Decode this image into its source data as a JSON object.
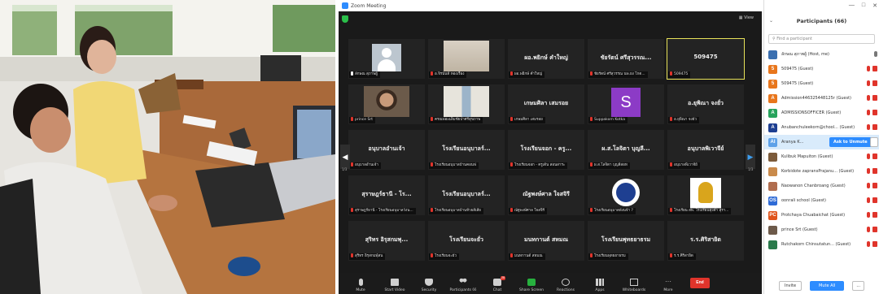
{
  "zoom": {
    "window_title": "Zoom Meeting",
    "view_label": "View",
    "page_left": "1/3",
    "page_right": "1/3",
    "tiles": [
      {
        "name": "",
        "label": "ลักษณ สุภาพผู้",
        "kind": "avatar",
        "mic_on": true
      },
      {
        "name": "",
        "label": "อ.จิรนันท์ ทองเรือง",
        "kind": "photo",
        "mic_on": false
      },
      {
        "name": "ผอ.พยิกษ์ คำใหญ่",
        "label": "ผอ.พยิกษ์ คำใหญ่",
        "kind": "text",
        "mic_on": false
      },
      {
        "name": "ชัยรัตน์ ศรีสุวรรณ...",
        "label": "ชัยรัตน์ ศรีสุวรรณ นพ.ยง โกต...",
        "kind": "text",
        "mic_on": false
      },
      {
        "name": "509475",
        "label": "509475",
        "kind": "text",
        "mic_on": false,
        "active": true
      },
      {
        "name": "",
        "label": "prince Srt",
        "kind": "photo2",
        "mic_on": false
      },
      {
        "name": "",
        "label": "ครณพ่อเฉลิมชัยป่าศรีสุขภาพ",
        "kind": "photo3",
        "mic_on": false
      },
      {
        "name": "เกษมศิลา เสมรอย",
        "label": "เกษมศิลา เสมรอย",
        "kind": "text",
        "mic_on": false
      },
      {
        "name": "",
        "label": "Suppakorn Kotka",
        "kind": "s",
        "mic_on": false
      },
      {
        "name": "อ.ยุพิณา จงยั่ว",
        "label": "อ.ยุพิณา จงยั่ว",
        "kind": "text",
        "mic_on": false
      },
      {
        "name": "อนุบาลอำนเจ้า",
        "label": "อนุบาลอำนเจ้า",
        "kind": "text",
        "mic_on": false
      },
      {
        "name": "โรงเรียนอนุบาลร์...",
        "label": "โรงเรียนอนุบาลบ้านคอนฟ",
        "kind": "text",
        "mic_on": false
      },
      {
        "name": "โรงเรียนจอก - ครู...",
        "label": "โรงเรียนจอก - ครูเต้น สอนสาระ",
        "kind": "text",
        "mic_on": false
      },
      {
        "name": "ผ.ส.โลจิตา บุญลี...",
        "label": "ผ.ส.โลจิตา บุญลีสอท",
        "kind": "text",
        "mic_on": false
      },
      {
        "name": "อนุบาลพิเวาจีย์",
        "label": "อนุบาลพิเวาจีย์",
        "kind": "text",
        "mic_on": false
      },
      {
        "name": "สุราษฎร์ธานี - โร...",
        "label": "สุราษฎร์ธานี - โรงเรียนอนุบาลวังน...",
        "kind": "text",
        "mic_on": false
      },
      {
        "name": "โรงเรียนอนุบาลร์...",
        "label": "โรงเรียนอนุบาลบ้านห้วยสีเสีย",
        "kind": "text",
        "mic_on": false
      },
      {
        "name": "ณัฐพงษ์ศาล ใจสจิรี",
        "label": "ณัฐพงษ์ศาล ใจสจิรี",
        "kind": "text",
        "mic_on": false
      },
      {
        "name": "",
        "label": "โรงเรียนอนุบาลพังนจ้า ?",
        "kind": "logo1",
        "mic_on": false
      },
      {
        "name": "",
        "label": "โรงเรียน สพ. โรงเรียนทุ่งตำ สุรา...",
        "kind": "logo2",
        "mic_on": false
      },
      {
        "name": "สุริทร อิรุสกมพุ...",
        "label": "สุริทร อิรุสกมพุ์สน",
        "kind": "text",
        "mic_on": false
      },
      {
        "name": "โรงเรียนจะยั่ว",
        "label": "โรงเรียนจะยั่ว",
        "kind": "text",
        "mic_on": false
      },
      {
        "name": "มนทกานต์ สหมณ",
        "label": "มนทกานต์ สหมณ",
        "kind": "text",
        "mic_on": false
      },
      {
        "name": "โรงเรียนพุทธยาธรม",
        "label": "โรงเรียนพุทธยาธรม",
        "kind": "text",
        "mic_on": false
      },
      {
        "name": "ร.ร.ศิริสายิด",
        "label": "ร.ร.ศิริสายิด",
        "kind": "text",
        "mic_on": false
      }
    ],
    "toolbar": {
      "mute": "Mute",
      "start_video": "Start Video",
      "security": "Security",
      "participants": "Participants",
      "participants_count": "66",
      "chat": "Chat",
      "chat_badge": "28",
      "share_screen": "Share Screen",
      "reactions": "Reactions",
      "apps": "Apps",
      "whiteboards": "Whiteboards",
      "more": "More",
      "end": "End"
    }
  },
  "panel": {
    "win_min": "—",
    "win_max": "□",
    "win_close": "✕",
    "title": "Participants (66)",
    "search_placeholder": "Find a participant",
    "participants": [
      {
        "name": "ลักษณ สุภาพผู้ (Host, me)",
        "color": "#3a6fb0",
        "initial": "",
        "photo": true,
        "mic_on": true,
        "cam": false
      },
      {
        "name": "509475 (Guest)",
        "color": "#e8761c",
        "initial": "5",
        "mic_on": false,
        "cam": true
      },
      {
        "name": "509475 (Guest)",
        "color": "#e8761c",
        "initial": "5",
        "mic_on": false,
        "cam": true
      },
      {
        "name": "Admission446325448125r (Guest)",
        "color": "#e8761c",
        "initial": "A",
        "mic_on": false,
        "cam": true
      },
      {
        "name": "ADMISSIONSOFFICER (Guest)",
        "color": "#27a35c",
        "initial": "A",
        "mic_on": false,
        "cam": true
      },
      {
        "name": "Anubanchuleekorn@chool... (Guest)",
        "color": "#1e3f91",
        "initial": "A",
        "mic_on": false,
        "cam": true
      },
      {
        "name": "Aranya K...",
        "color": "#5ea1e8",
        "initial": "AI",
        "mic_on": false,
        "cam": false,
        "highlight": true,
        "unmute": "Ask to Unmute"
      },
      {
        "name": "Kulibuk Mapuiton (Guest)",
        "color": "#7c5b3a",
        "initial": "",
        "photo": true,
        "mic_on": false,
        "cam": true
      },
      {
        "name": "Korbidote zapransPrajanu... (Guest)",
        "color": "#c98a4b",
        "initial": "",
        "photo": true,
        "mic_on": false,
        "cam": true
      },
      {
        "name": "Naowanon Chanbroang (Guest)",
        "color": "#b06d4e",
        "initial": "",
        "photo": true,
        "mic_on": false,
        "cam": true
      },
      {
        "name": "oonrali school (Guest)",
        "color": "#2f6bd6",
        "initial": "OS",
        "mic_on": false,
        "cam": true
      },
      {
        "name": "Protchaya Chuabaichat (Guest)",
        "color": "#e0541c",
        "initial": "PC",
        "mic_on": false,
        "cam": true
      },
      {
        "name": "prince Srt (Guest)",
        "color": "#6d5a4a",
        "initial": "",
        "photo": true,
        "mic_on": false,
        "cam": true
      },
      {
        "name": "Rutchakorn Chinsutatun... (Guest)",
        "color": "#2a7a4b",
        "initial": "",
        "photo": true,
        "mic_on": false,
        "cam": true
      }
    ],
    "footer": {
      "invite": "Invite",
      "mute_all": "Mute All",
      "more": "..."
    }
  }
}
